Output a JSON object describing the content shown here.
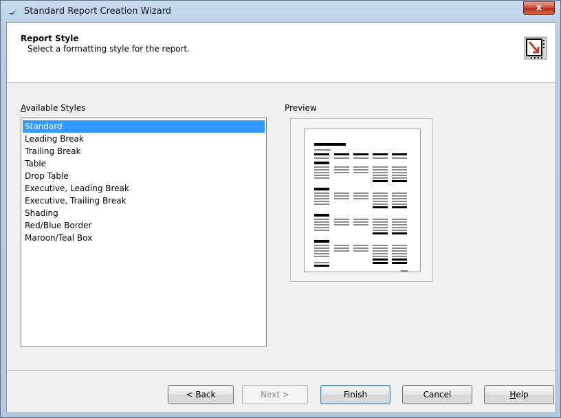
{
  "window": {
    "title": "Standard Report Creation Wizard",
    "close_label": "x"
  },
  "header": {
    "title": "Report Style",
    "subtitle": "Select a formatting style for the report."
  },
  "styles": {
    "label_mnemonic": "A",
    "label_rest": "vailable Styles",
    "selected_index": 0,
    "items": [
      "Standard",
      "Leading Break",
      "Trailing Break",
      "Table",
      "Drop Table",
      "Executive, Leading Break",
      "Executive, Trailing Break",
      "Shading",
      "Red/Blue Border",
      "Maroon/Teal Box"
    ]
  },
  "preview": {
    "label": "Preview"
  },
  "buttons": {
    "back": "< Back",
    "next": "Next >",
    "finish": "Finish",
    "cancel": "Cancel",
    "help_mnemonic": "H",
    "help_rest": "elp"
  },
  "colors": {
    "selection": "#3399ff",
    "close_button": "#c8432d"
  }
}
